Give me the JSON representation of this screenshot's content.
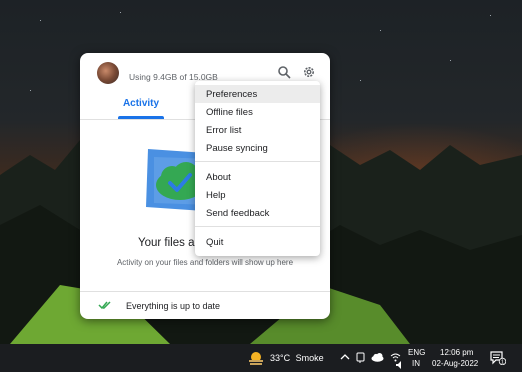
{
  "panel": {
    "usage_text": "Using 9.4GB of 15.0GB",
    "tabs": {
      "activity_label": "Activity"
    },
    "empty_state": {
      "title": "Your files a",
      "subtitle": "Activity on your files and folders will show up here"
    },
    "status": {
      "text": "Everything is up to date"
    },
    "accent_color": "#1a73e8"
  },
  "menu": {
    "groups": [
      [
        "Preferences",
        "Offline files",
        "Error list",
        "Pause syncing"
      ],
      [
        "About",
        "Help",
        "Send feedback"
      ],
      [
        "Quit"
      ]
    ],
    "highlighted_item": "Preferences"
  },
  "taskbar": {
    "weather": {
      "temp": "33°C",
      "condition": "Smoke"
    },
    "language": {
      "line1": "ENG",
      "line2": "IN"
    },
    "clock": {
      "time": "12:06 pm",
      "date": "02-Aug-2022"
    },
    "notification_count": "1",
    "tray_icons": [
      "chevron-up-icon",
      "meet-now-icon",
      "cloud-icon",
      "wifi-icon",
      "volume-icon"
    ]
  }
}
